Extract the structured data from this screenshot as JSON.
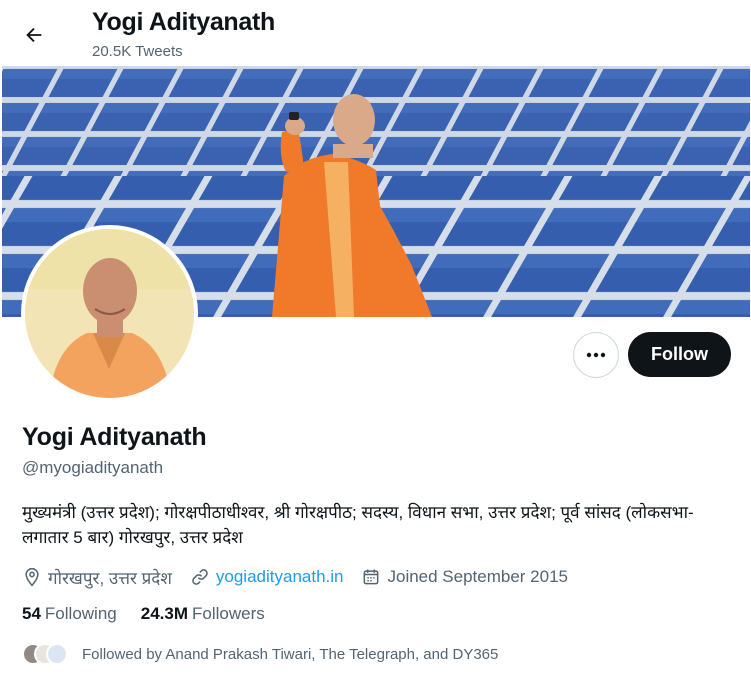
{
  "header": {
    "title": "Yogi Adityanath",
    "tweet_count": "20.5K Tweets"
  },
  "actions": {
    "follow_label": "Follow"
  },
  "profile": {
    "name": "Yogi Adityanath",
    "handle": "@myogiadityanath",
    "bio": "मुख्यमंत्री (उत्तर प्रदेश); गोरक्षपीठाधीश्वर, श्री गोरक्षपीठ; सदस्य, विधान सभा, उत्तर प्रदेश; पूर्व सांसद (लोकसभा-लगातार 5 बार) गोरखपुर, उत्तर प्रदेश",
    "location": "गोरखपुर, उत्तर प्रदेश",
    "website": "yogiadityanath.in",
    "joined": "Joined September 2015"
  },
  "stats": {
    "following_count": "54",
    "following_label": "Following",
    "followers_count": "24.3M",
    "followers_label": "Followers"
  },
  "followed_by": "Followed by Anand Prakash Tiwari, The Telegraph, and DY365",
  "colors": {
    "accent": "#1d9bf0",
    "text": "#0f1419",
    "secondary": "#536471",
    "follow_bg": "#0f1419"
  }
}
